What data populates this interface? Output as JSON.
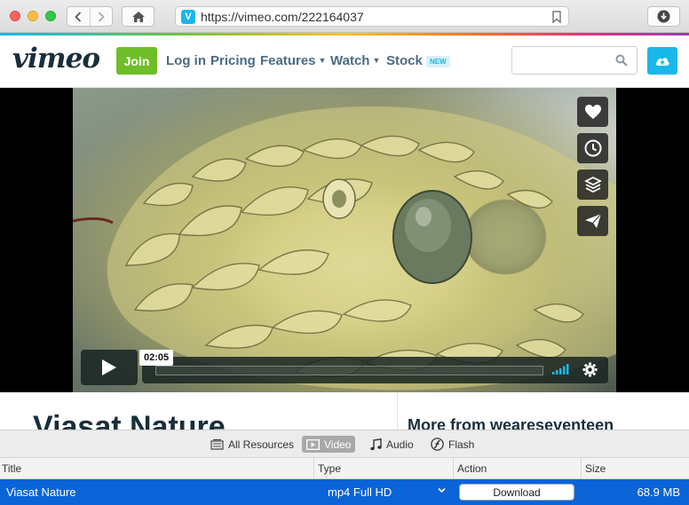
{
  "browser": {
    "url": "https://vimeo.com/222164037",
    "site_icon_letter": "V",
    "icons": [
      "back-icon",
      "forward-icon",
      "home-icon",
      "bookmark-icon",
      "download-icon"
    ]
  },
  "header": {
    "logo": "vimeo",
    "join_label": "Join",
    "login_label": "Log in",
    "pricing_label": "Pricing",
    "features_label": "Features",
    "watch_label": "Watch",
    "stock_label": "Stock",
    "new_badge": "NEW",
    "search_placeholder": "",
    "colors": {
      "brand": "#1ab7ea",
      "join": "#6fbd29",
      "nav": "#4a6b85"
    }
  },
  "player": {
    "current_time": "02:05",
    "side_icons": [
      "heart-icon",
      "clock-icon",
      "layers-icon",
      "send-icon"
    ]
  },
  "page": {
    "video_title": "Viasat Nature",
    "more_from": "More from weareseventeen"
  },
  "resources": {
    "tabs": [
      {
        "label": "All Resources",
        "icon": "resources-icon",
        "active": false
      },
      {
        "label": "Video",
        "icon": "video-icon",
        "active": true
      },
      {
        "label": "Audio",
        "icon": "music-icon",
        "active": false
      },
      {
        "label": "Flash",
        "icon": "flash-icon",
        "active": false
      }
    ],
    "columns": [
      "Title",
      "Type",
      "Action",
      "Size"
    ],
    "rows": [
      {
        "title": "Viasat Nature",
        "type": "mp4 Full HD",
        "action": "Download",
        "size": "68.9 MB"
      }
    ],
    "selected_color": "#0a64d8"
  }
}
